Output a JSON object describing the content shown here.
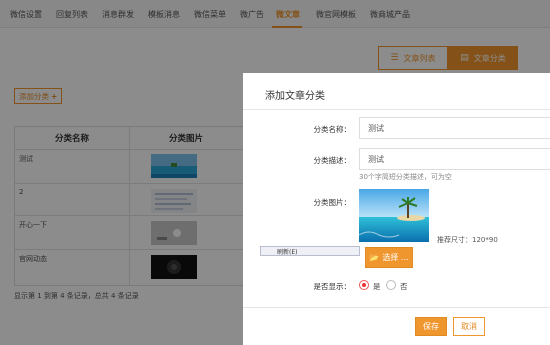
{
  "nav": {
    "items": [
      "微信设置",
      "回复列表",
      "消息群发",
      "模板消息",
      "微信菜单",
      "微广告",
      "微文章",
      "微官网模板",
      "微商城产品"
    ],
    "active_index": 6
  },
  "tabs": {
    "list_label": "文章列表",
    "category_label": "文章分类"
  },
  "add_category_label": "添加分类",
  "table": {
    "headers": [
      "分类名称",
      "分类图片"
    ],
    "rows": [
      {
        "name": "测试"
      },
      {
        "name": "2"
      },
      {
        "name": "开心一下"
      },
      {
        "name": "官网动态"
      }
    ],
    "footer": "显示第 1 到第 4 条记录，总共 4 条记录"
  },
  "dialog": {
    "title": "添加文章分类",
    "name_label": "分类名称：",
    "name_value": "测试",
    "desc_label": "分类描述：",
    "desc_value": "测试",
    "desc_hint": "30个字简短分类描述，可为空",
    "image_label": "分类图片：",
    "size_hint": "推荐尺寸：120*90",
    "choose_label": "选择 ...",
    "display_label": "是否显示：",
    "yes_label": "是",
    "no_label": "否",
    "display_value": "yes",
    "save_label": "保存",
    "cancel_label": "取消"
  },
  "tooltip": "刷新(E)",
  "colors": {
    "accent": "#f0962e",
    "radio_on": "#e33333"
  }
}
